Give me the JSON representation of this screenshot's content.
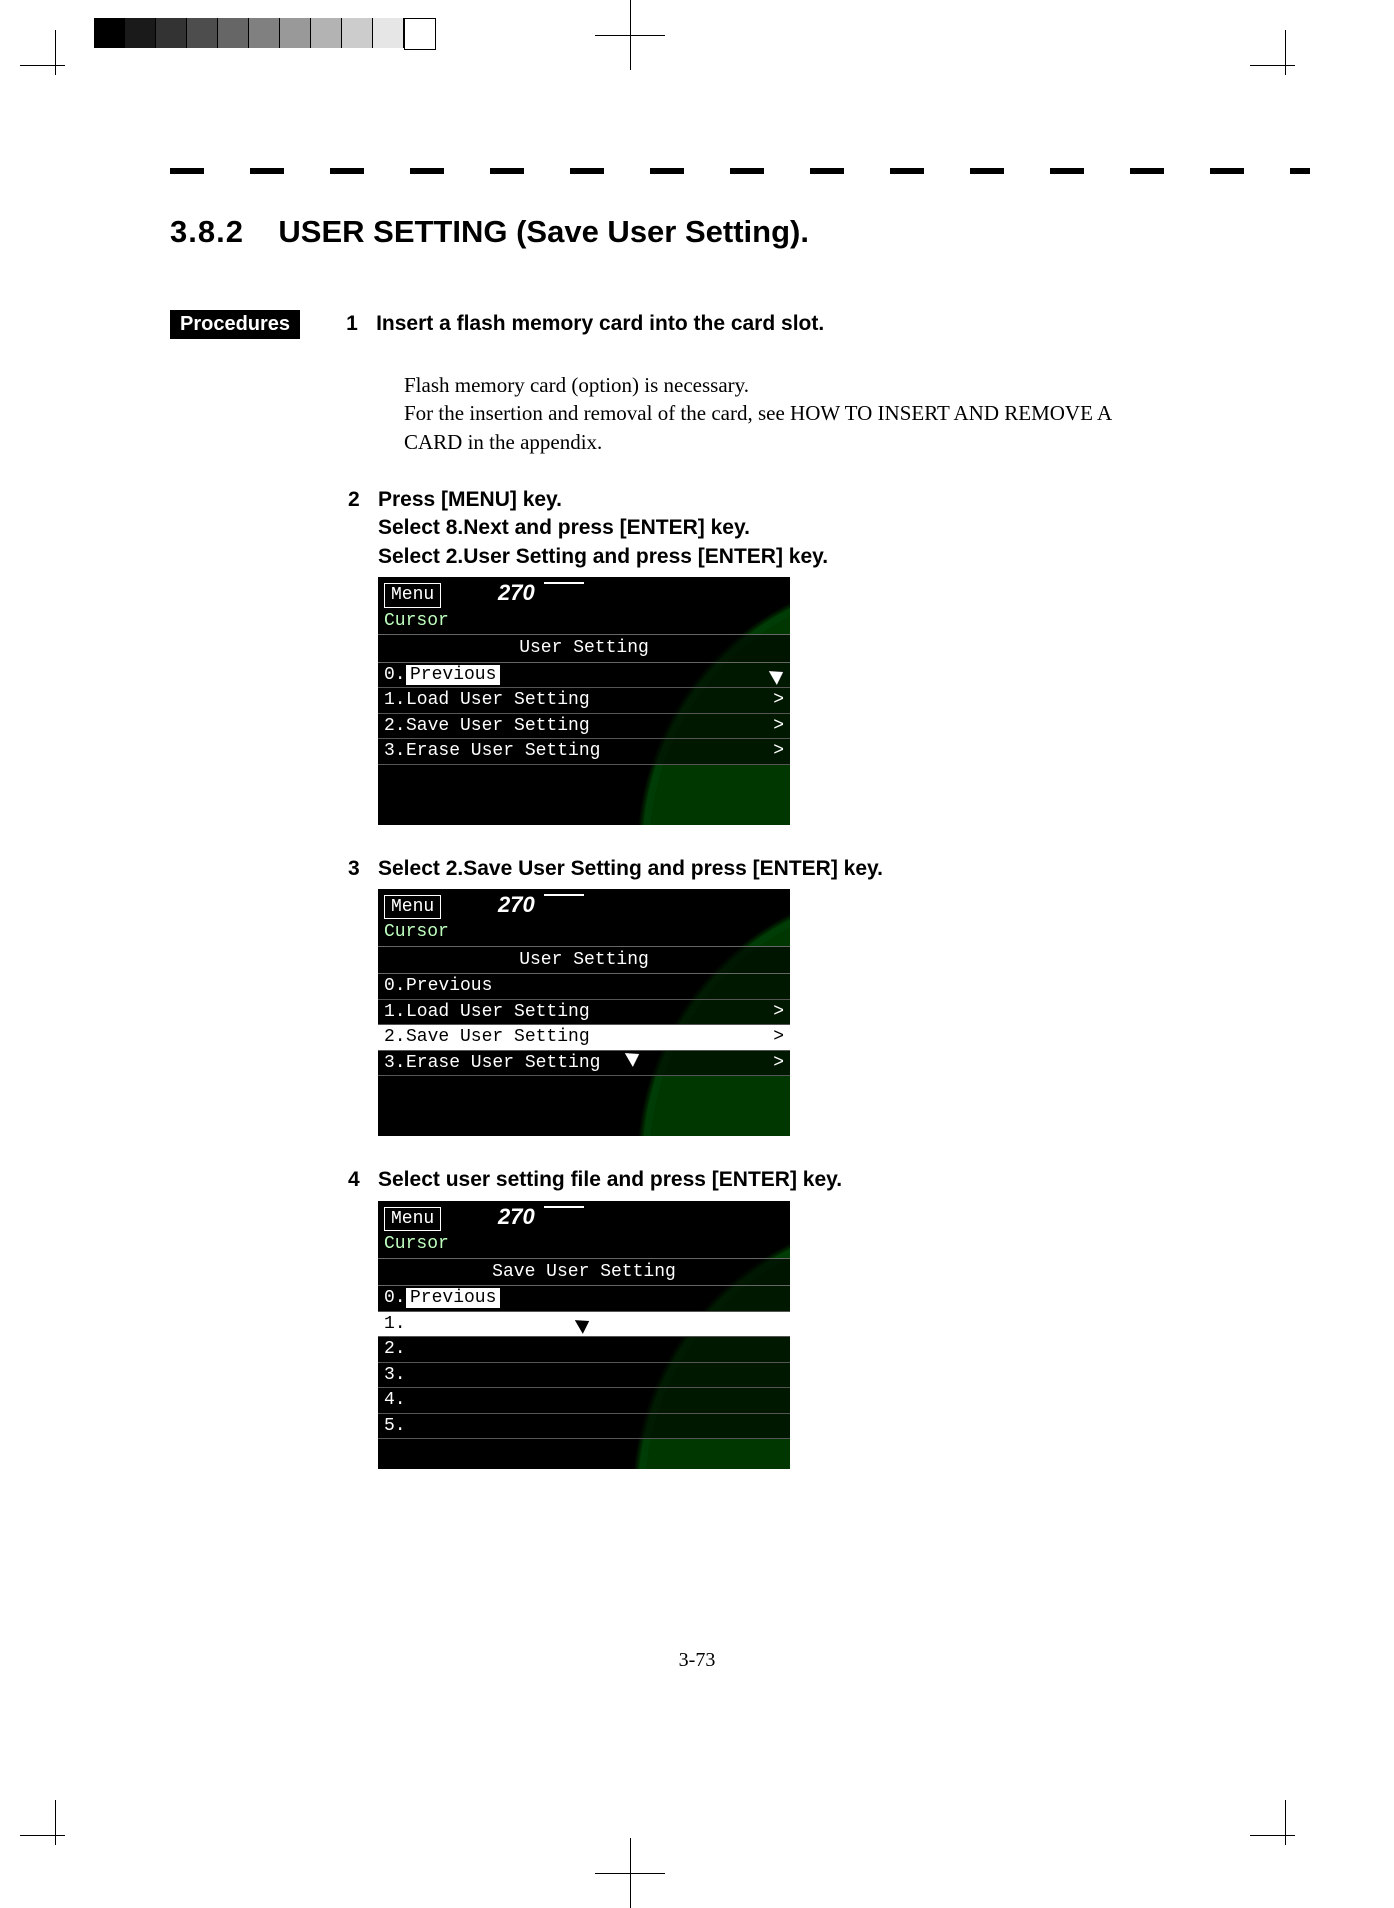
{
  "section": {
    "number": "3.8.2",
    "title": "USER SETTING (Save User Setting)."
  },
  "tag": "Procedures",
  "steps": {
    "s1": {
      "n": "1",
      "title": "Insert a flash memory card into the card slot.",
      "body1": "Flash memory card (option) is necessary.",
      "body2": "For the insertion and removal of the card, see HOW TO INSERT AND REMOVE A CARD in the appendix."
    },
    "s2": {
      "n": "2",
      "l1": "Press [MENU] key.",
      "l2": "Select    8.Next    and press [ENTER] key.",
      "l3": "Select    2.User Setting and press [ENTER] key."
    },
    "s3": {
      "n": "3",
      "title": "Select 2.Save User Setting and press [ENTER] key."
    },
    "s4": {
      "n": "4",
      "title": "Select    user setting file and press [ENTER] key."
    }
  },
  "shot_common": {
    "heading": "270",
    "menu_btn": "Menu",
    "cursor": "Cursor",
    "arrow": ">"
  },
  "shot1": {
    "title": "User  Setting",
    "r0n": "0.",
    "r0": "Previous",
    "r1n": "1.",
    "r1": "Load  User  Setting",
    "r2n": "2.",
    "r2": "Save  User  Setting",
    "r3n": "3.",
    "r3": "Erase  User  Setting"
  },
  "shot2": {
    "title": "User  Setting",
    "r0n": "0.",
    "r0": "Previous",
    "r1n": "1.",
    "r1": "Load  User  Setting",
    "r2n": "2.",
    "r2": "Save  User  Setting",
    "r3n": "3.",
    "r3": "Erase  User  Setting"
  },
  "shot3": {
    "title": "Save  User  Setting",
    "r0n": "0.",
    "r0": "Previous",
    "r1n": "1.",
    "r2n": "2.",
    "r3n": "3.",
    "r4n": "4.",
    "r5n": "5."
  },
  "page_number": "3-73"
}
